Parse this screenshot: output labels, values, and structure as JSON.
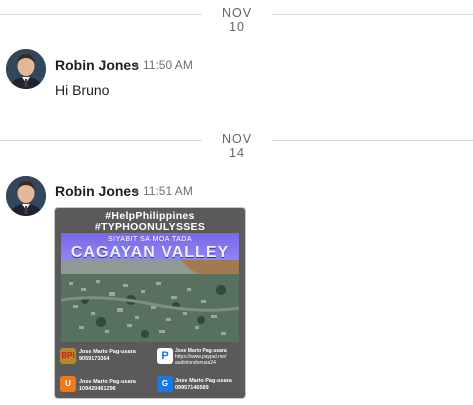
{
  "dividers": [
    {
      "label": "NOV 10"
    },
    {
      "label": "NOV 14"
    }
  ],
  "messages": [
    {
      "sender": "Robin Jones",
      "separator": "•",
      "time": "11:50 AM",
      "text": "Hi Bruno"
    },
    {
      "sender": "Robin Jones",
      "separator": "•",
      "time": "11:51 AM",
      "attachment": {
        "hashtag1": "#HelpPhilippines",
        "hashtag2": "#TYPHOONULYSSES",
        "banner_small": "SIYABIT SA MOA TADA",
        "banner_big": "CAGAYAN VALLEY",
        "banner_tag": "# # # #",
        "payments": [
          {
            "brand": "BPI",
            "name": "Jose Mario Pag-usara",
            "number": "9059173364"
          },
          {
            "brand": "P",
            "name": "Jose Mario Pag-usara",
            "number": "https://www.paypal.me/ audiolondonusa24"
          },
          {
            "brand": "U",
            "name": "Jose Mario Pag-usara",
            "number": "109420461296"
          },
          {
            "brand": "G",
            "name": "Jose Mario Pag-usara",
            "number": "09957146589"
          }
        ]
      }
    }
  ],
  "colors": {
    "banner": "#7668e9",
    "paypal": "#1677d3",
    "unionbank": "#f07a1a",
    "gcash": "#1a78e6"
  }
}
